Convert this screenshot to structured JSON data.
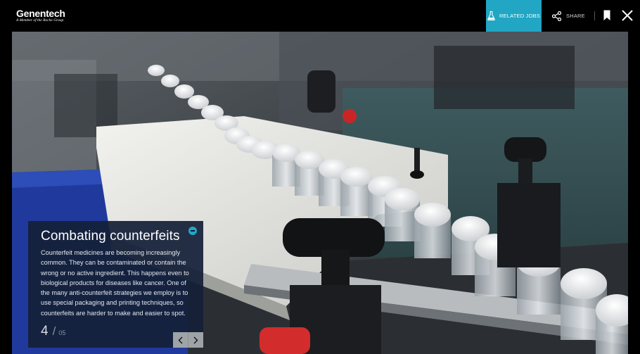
{
  "header": {
    "logo_text": "Genentech",
    "logo_subtext": "A Member of the Roche Group",
    "related_jobs_label": "RELATED JOBS",
    "share_label": "SHARE"
  },
  "slide": {
    "title": "Combating counterfeits",
    "body": "Counterfeit medicines are becoming increasingly common. They can be contaminated or contain the wrong or no active ingredient. This happens even to biological products for diseases like cancer. One of the many anti-counterfeit strategies we employ is to use special packaging and printing techniques, so counterfeits are harder to make and easier to spot.",
    "current": "4",
    "separator": "/",
    "total": "05"
  },
  "icons": {
    "related_jobs": "flask-icon",
    "share": "share-icon",
    "bookmark": "bookmark-icon",
    "close": "close-icon",
    "toggle": "minus-icon",
    "prev": "chevron-left-icon",
    "next": "chevron-right-icon"
  },
  "colors": {
    "accent": "#21a6c4",
    "caption_bg": "#142038"
  }
}
